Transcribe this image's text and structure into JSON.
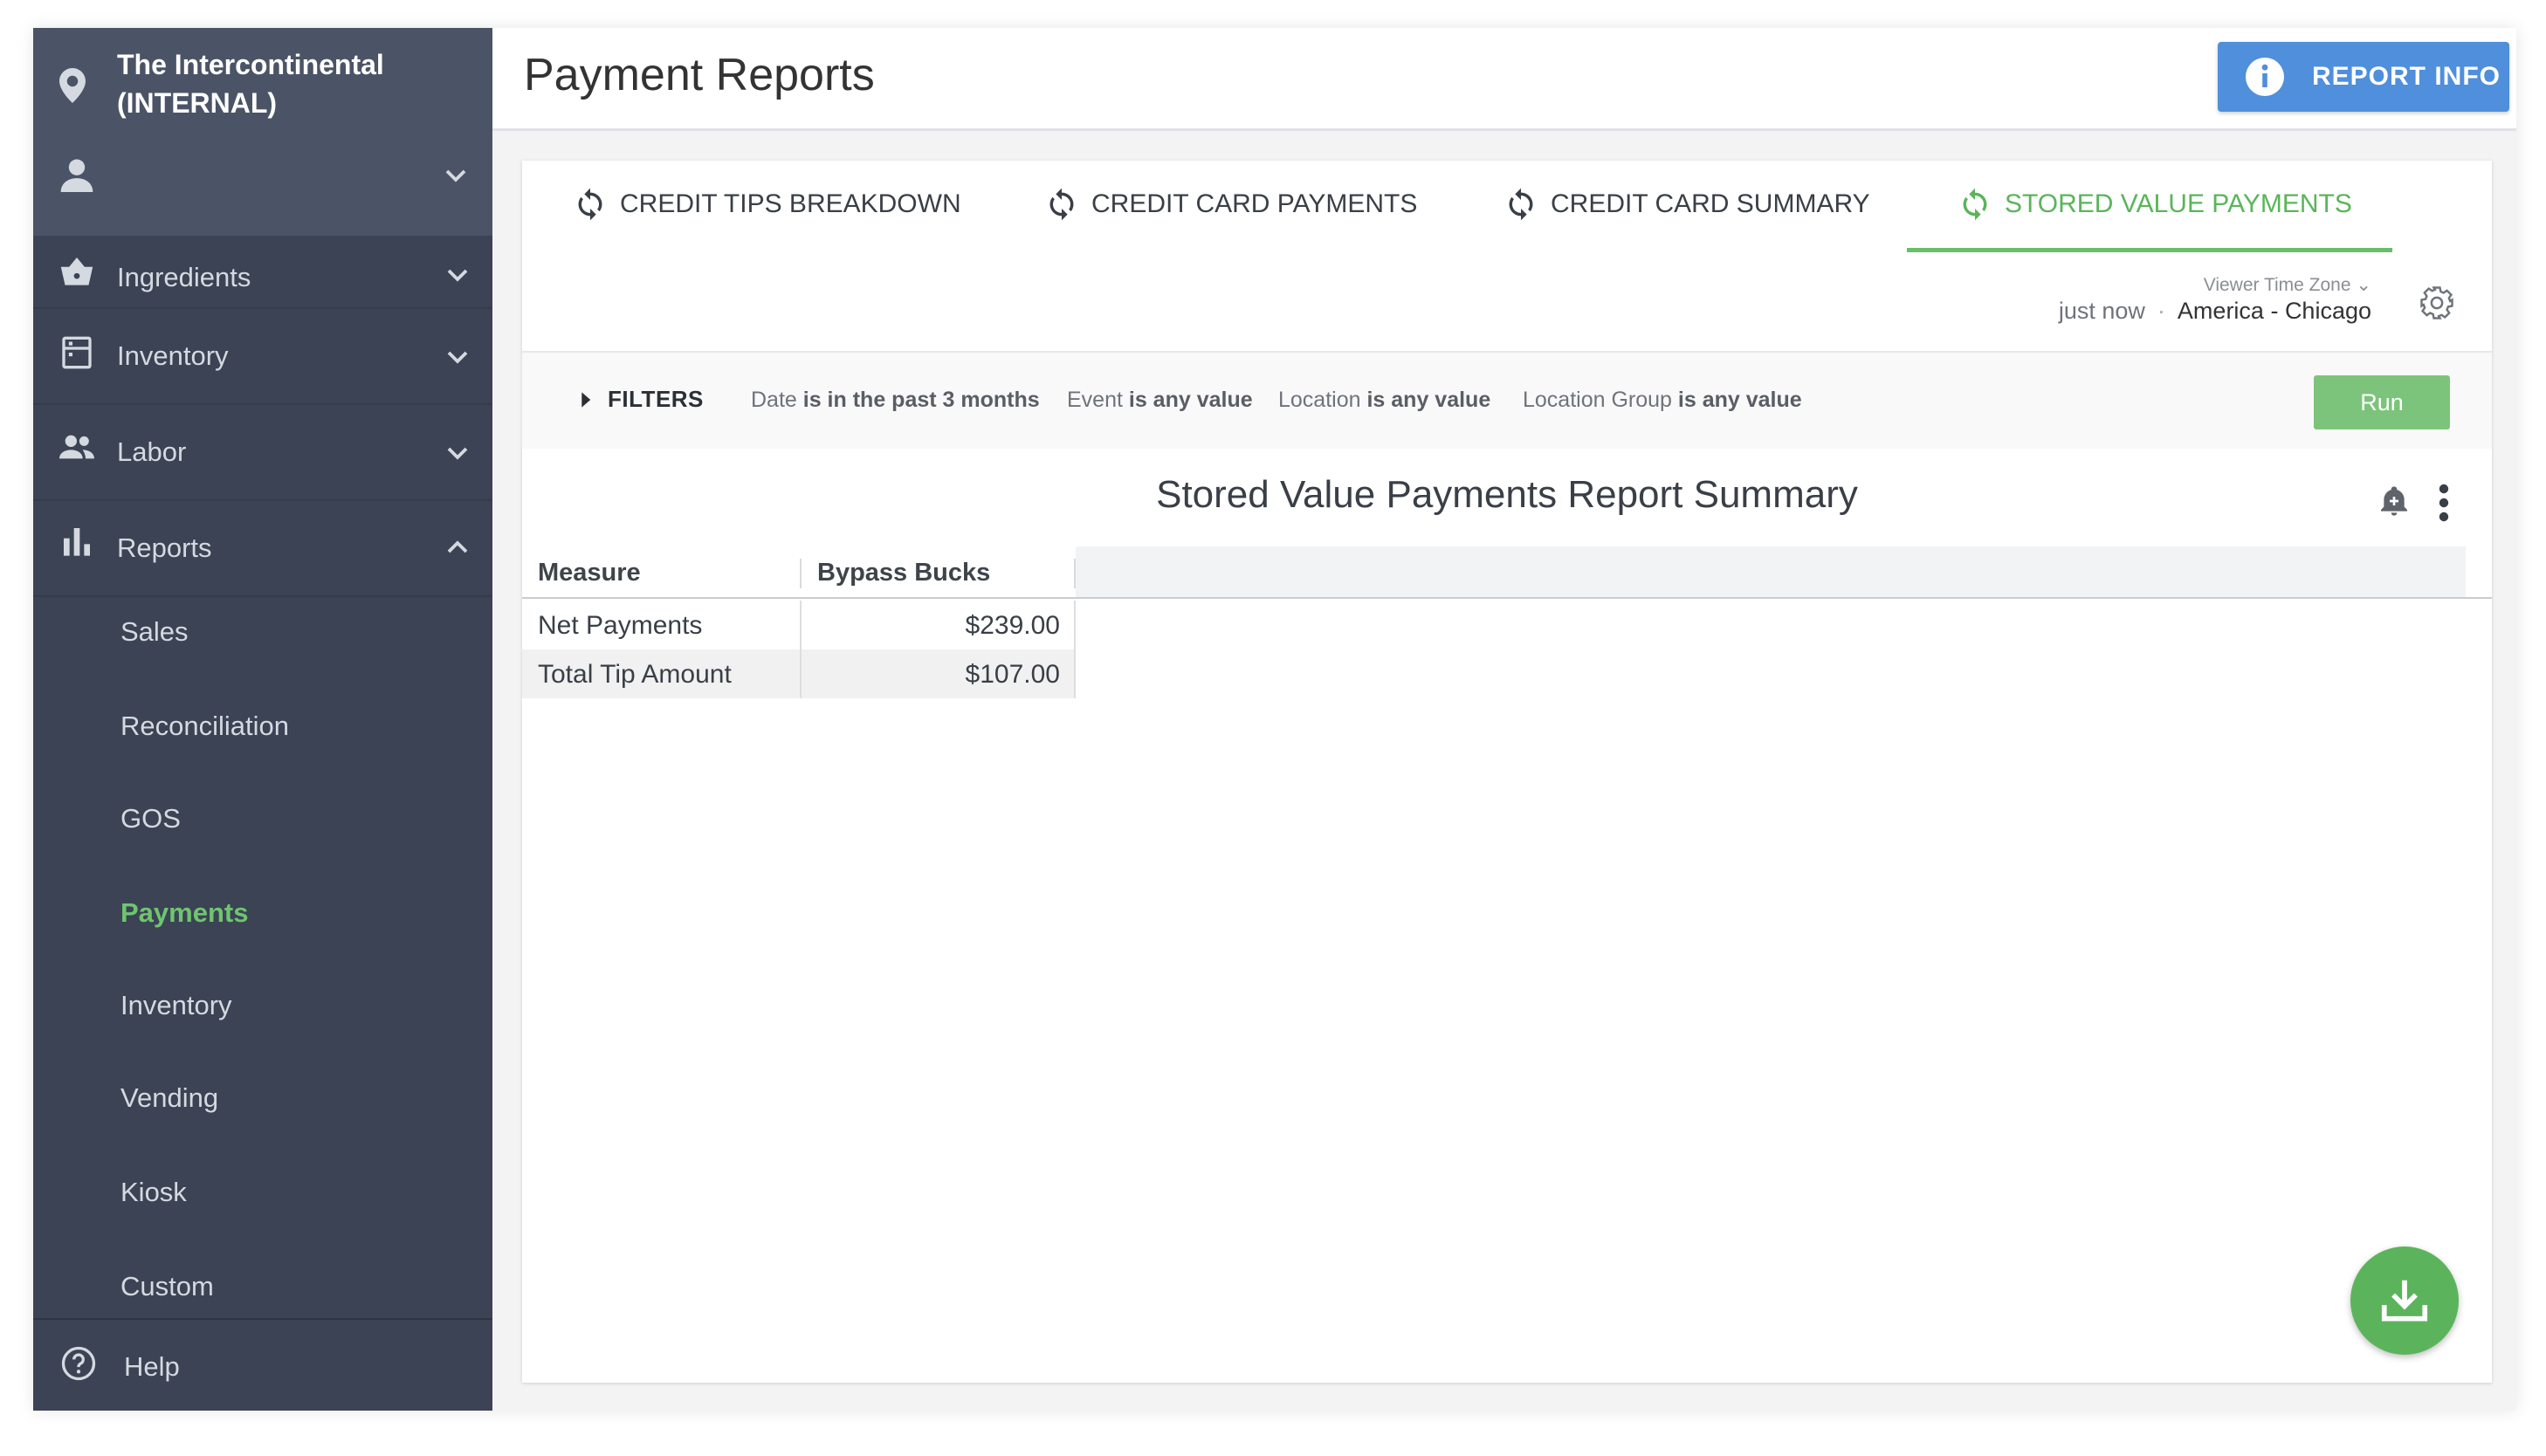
{
  "sidebar": {
    "location_line1": "The Intercontinental",
    "location_line2": "(INTERNAL)",
    "items": [
      {
        "label": "Ingredients",
        "icon": "basket-icon",
        "expanded": false
      },
      {
        "label": "Inventory",
        "icon": "clipboard-icon",
        "expanded": false
      },
      {
        "label": "Labor",
        "icon": "people-icon",
        "expanded": false
      },
      {
        "label": "Reports",
        "icon": "bar-chart-icon",
        "expanded": true
      }
    ],
    "report_sub_items": [
      "Sales",
      "Reconciliation",
      "GOS",
      "Payments",
      "Inventory",
      "Vending",
      "Kiosk",
      "Custom"
    ],
    "active_sub_item": "Payments",
    "help_label": "Help"
  },
  "header": {
    "title": "Payment Reports",
    "report_info_label": "REPORT INFO"
  },
  "tabs": [
    {
      "label": "CREDIT TIPS BREAKDOWN",
      "active": false
    },
    {
      "label": "CREDIT CARD PAYMENTS",
      "active": false
    },
    {
      "label": "CREDIT CARD SUMMARY",
      "active": false
    },
    {
      "label": "STORED VALUE PAYMENTS",
      "active": true
    }
  ],
  "timezone": {
    "label": "Viewer Time Zone",
    "updated": "just now",
    "separator": "·",
    "value": "America - Chicago"
  },
  "filters": {
    "toggle_label": "FILTERS",
    "items": [
      {
        "field": "Date",
        "condition": "is in the past 3 months"
      },
      {
        "field": "Event",
        "condition": "is any value"
      },
      {
        "field": "Location",
        "condition": "is any value"
      },
      {
        "field": "Location Group",
        "condition": "is any value"
      }
    ],
    "run_label": "Run"
  },
  "report": {
    "title": "Stored Value Payments Report Summary",
    "columns": [
      "Measure",
      "Bypass Bucks"
    ],
    "rows": [
      {
        "measure": "Net Payments",
        "value": "$239.00"
      },
      {
        "measure": "Total Tip Amount",
        "value": "$107.00"
      }
    ]
  },
  "colors": {
    "sidebar_bg": "#3b4354",
    "accent_green": "#5ab55a",
    "info_blue": "#4f8fdc"
  }
}
